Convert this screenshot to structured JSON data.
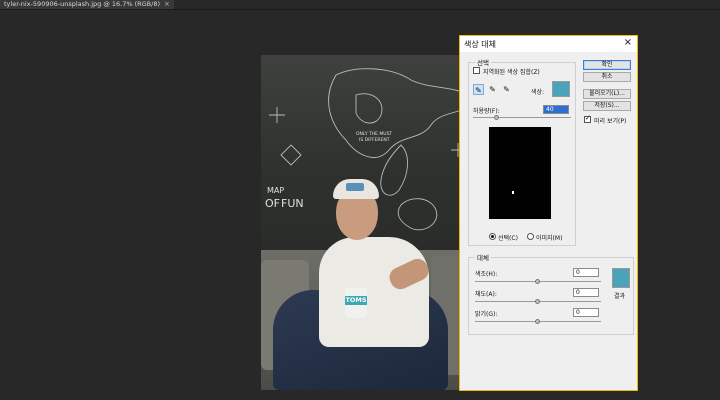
{
  "document_tab": {
    "title": "tyler-nix-590906-unsplash.jpg @ 16.7% (RGB/8)",
    "close": "×"
  },
  "photo": {
    "cup_label": "TOMS"
  },
  "dialog": {
    "title": "색상 대체",
    "close": "×",
    "selection": {
      "legend": "선택",
      "localized_clusters_label": "지역화된 색상 집합(Z)",
      "localized_clusters_checked": false,
      "color_label": "색상:",
      "color_swatch": "#4aa3b8",
      "fuzziness_label": "허용량(F):",
      "fuzziness_value": "40",
      "fuzziness_fraction": 0.2,
      "tools": [
        "eyedropper-icon",
        "eyedropper-plus-icon",
        "eyedropper-minus-icon"
      ],
      "radio_selection": "선택(C)",
      "radio_image": "이미지(M)",
      "radio_selected": "selection"
    },
    "replacement": {
      "legend": "대체",
      "hue_label": "색조(H):",
      "hue_value": "0",
      "saturation_label": "채도(A):",
      "saturation_value": "0",
      "lightness_label": "밝기(G):",
      "lightness_value": "0",
      "result_label": "결과",
      "result_swatch": "#4aa3b8"
    },
    "buttons": {
      "ok": "확인",
      "cancel": "취소",
      "load": "불러오기(L)...",
      "save": "저장(S)...",
      "preview_label": "미리 보기(P)",
      "preview_checked": true
    }
  }
}
